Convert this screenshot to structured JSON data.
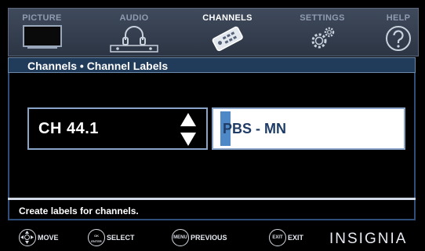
{
  "tabs": [
    {
      "label": "PICTURE",
      "icon": "tv-icon"
    },
    {
      "label": "AUDIO",
      "icon": "headphones-icon"
    },
    {
      "label": "CHANNELS",
      "icon": "remote-control-icon",
      "active": true
    },
    {
      "label": "SETTINGS",
      "icon": "gears-icon"
    },
    {
      "label": "HELP",
      "icon": "question-icon"
    }
  ],
  "page": {
    "title": "Channels • Channel Labels"
  },
  "channel": {
    "value": "CH  44.1"
  },
  "label_field": {
    "value": "PBS - MN"
  },
  "help": {
    "text": "Create labels for channels."
  },
  "hints": [
    {
      "label": "MOVE",
      "icon": "dpad-icon",
      "icon_text": ""
    },
    {
      "label": "SELECT",
      "icon": "ok-enter-icon",
      "icon_text": "OK ENTER"
    },
    {
      "label": "PREVIOUS",
      "icon": "menu-button-icon",
      "icon_text": "MENU"
    },
    {
      "label": "EXIT",
      "icon": "exit-button-icon",
      "icon_text": "EXIT"
    }
  ],
  "brand": "INSIGNIA",
  "colors": {
    "accent": "#4f88c6",
    "title_bar": "#213b5a",
    "border": "#8aa4c7",
    "label_text": "#1f3c66"
  }
}
